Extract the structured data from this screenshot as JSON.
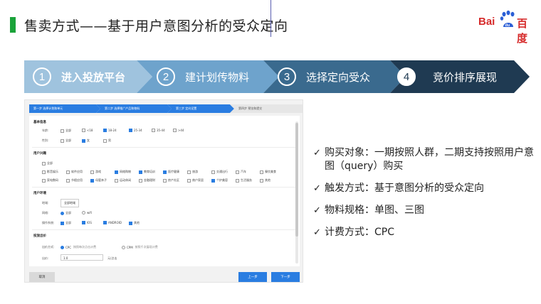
{
  "header": {
    "title": "售卖方式——基于用户意图分析的受众定向",
    "logo_bai": "Bai",
    "logo_du": "du",
    "logo_cn": "百度"
  },
  "steps": [
    {
      "num": "1",
      "label": "进入投放平台"
    },
    {
      "num": "2",
      "label": "建计划传物料"
    },
    {
      "num": "3",
      "label": "选择定向受众"
    },
    {
      "num": "4",
      "label": "竞价排序展现"
    }
  ],
  "screenshot": {
    "tabs": [
      "第一步 选择计划和单元",
      "第二步 选择推广产品和物料",
      "第三步 定向设置",
      "第四步 预览和提交"
    ],
    "basic": {
      "title": "基本信息",
      "age_label": "年龄:",
      "ages": [
        "全部",
        "<18",
        "18-24",
        "25-34",
        "35-44",
        ">44"
      ],
      "gender_label": "性别:",
      "genders": [
        "全部",
        "女",
        "男"
      ]
    },
    "interest": {
      "title": "用户兴趣",
      "all": "全部",
      "row1": [
        "影音娱乐",
        "软件应用",
        "游戏",
        "网络购物",
        "教育培训",
        "医疗健康",
        "旅游",
        "交通出行",
        "汽车",
        "餐饮美食"
      ],
      "row2": [
        "家电数码",
        "节假应用",
        "母婴亲子",
        "运动休闲",
        "金融理财",
        "房产社区",
        "商户家居",
        "个护美容",
        "生活服务",
        "其他"
      ]
    },
    "env": {
      "title": "用户环境",
      "region_label": "地域:",
      "region_btn": "全部地域",
      "network_label": "网络:",
      "networks": [
        "全部",
        "wifi"
      ],
      "os_label": "操作系统:",
      "os": [
        "全部",
        "IOS",
        "ANDROID",
        "其他"
      ]
    },
    "bid": {
      "title": "投放出价",
      "mode_label": "出价方式:",
      "cpc": "CPC",
      "cpc_hint": "按照每次点击计费",
      "cpm": "CPM",
      "cpm_hint": "按照千次展现计费",
      "price_label": "出价:",
      "price_value": "1.0",
      "price_unit": "元/点击"
    },
    "buttons": {
      "cancel": "取消",
      "prev": "上一步",
      "next": "下一步"
    }
  },
  "bullets": [
    {
      "check": "✓",
      "text": "购买对象：一期按照人群，二期支持按照用户意图（query）购买"
    },
    {
      "check": "✓",
      "text": "触发方式：基于意图分析的受众定向"
    },
    {
      "check": "✓",
      "text": "物料规格：单图、三图"
    },
    {
      "check": "✓",
      "text": "计费方式：CPC"
    }
  ],
  "colors": {
    "green_bar": "#1aa33a",
    "step1": "#9fc3de",
    "step2": "#6ea3cc",
    "step3": "#3a6a8e",
    "step4": "#1f3a52",
    "baidu_red": "#d62b2b",
    "accent_blue": "#2a7de1"
  }
}
